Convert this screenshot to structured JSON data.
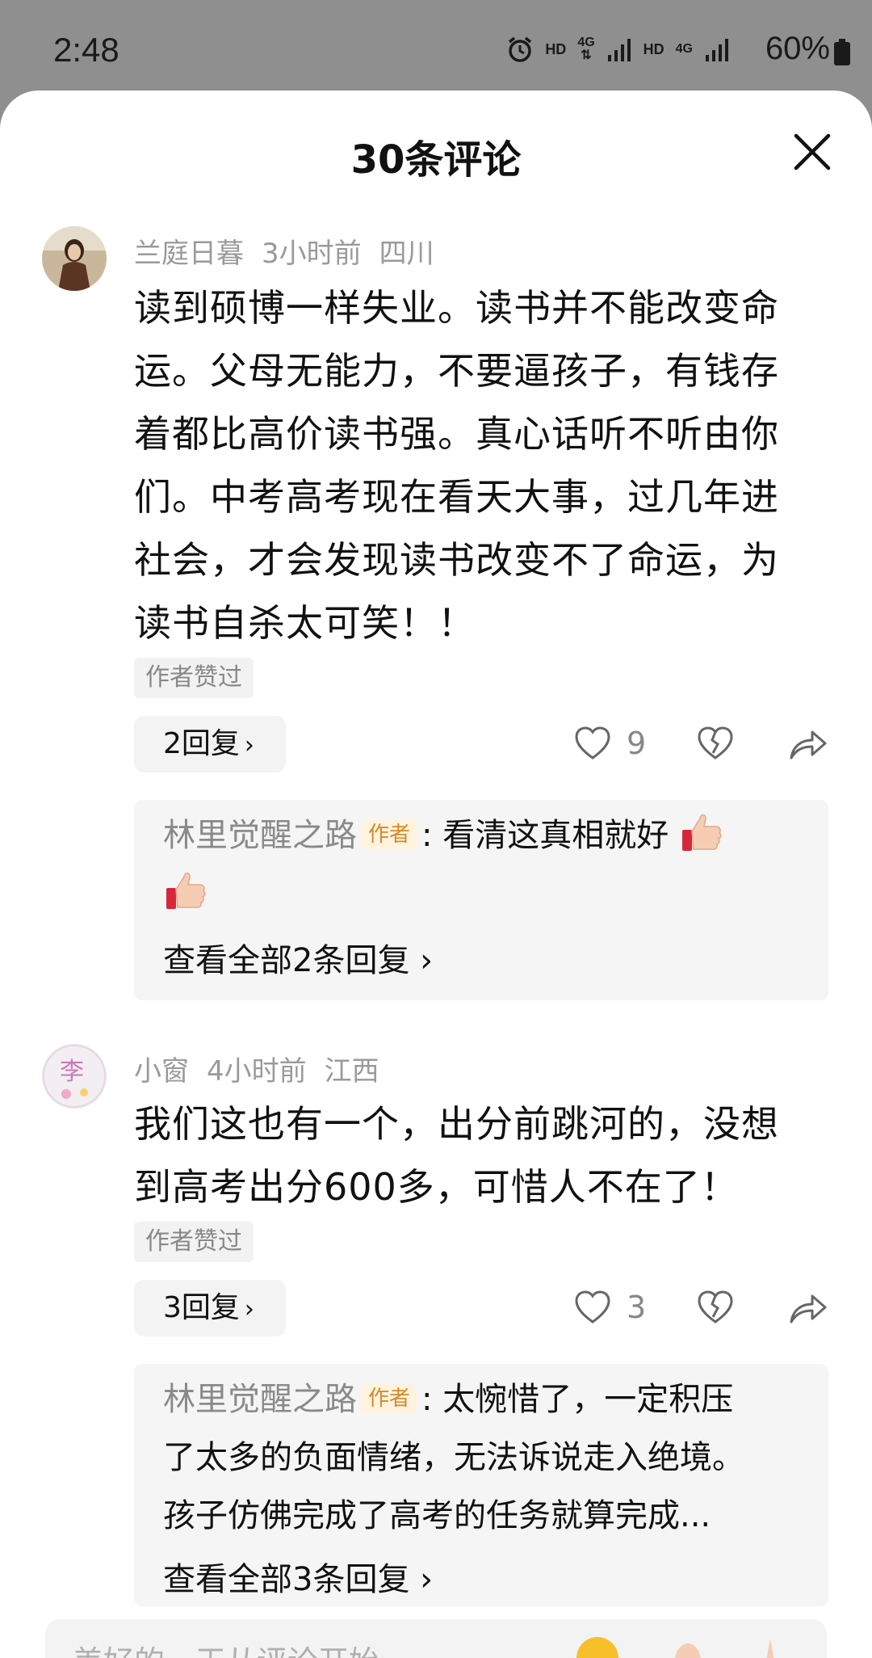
{
  "status_bar": {
    "time": "2:48",
    "hd1": "HD",
    "net1": "4G",
    "hd2": "HD",
    "net2": "4G",
    "battery": "60%"
  },
  "sheet": {
    "title": "30条评论"
  },
  "comments": [
    {
      "username": "兰庭日暮",
      "time": "3小时前",
      "location": "四川",
      "text": "读到硕博一样失业。读书并不能改变命运。父母无能力，不要逼孩子，有钱存着都比高价读书强。真心话听不听由你们。中考高考现在看天大事，过几年进社会，才会发现读书改变不了命运，为读书自杀太可笑！！",
      "text_lines": [
        "读到硕博一样失业。读书并不能改变命",
        "运。父母无能力，不要逼孩子，有钱存",
        "着都比高价读书强。真心话听不听由你",
        "们。中考高考现在看天大事，过几年进",
        "社会，才会发现读书改变不了命运，为",
        "读书自杀太可笑！！"
      ],
      "author_liked": "作者赞过",
      "reply_button": "2回复",
      "like_count": "9",
      "reply_preview": {
        "author": "林里觉醒之路",
        "author_tag": "作者",
        "text": "看清这真相就好",
        "view_all": "查看全部2条回复"
      }
    },
    {
      "username": "小窗",
      "time": "4小时前",
      "location": "江西",
      "text": "我们这也有一个，出分前跳河的，没想到高考出分600多，可惜人不在了！",
      "text_lines": [
        "我们这也有一个，出分前跳河的，没想",
        "到高考出分600多，可惜人不在了！"
      ],
      "author_liked": "作者赞过",
      "reply_button": "3回复",
      "like_count": "3",
      "reply_preview": {
        "author": "林里觉醒之路",
        "author_tag": "作者",
        "text_lines": [
          "太惋惜了，一定积压",
          "了太多的负面情绪，无法诉说走入绝境。",
          "孩子仿佛完成了高考的任务就算完成..."
        ],
        "view_all": "查看全部3条回复"
      }
    }
  ],
  "input": {
    "placeholder": "美好的一天从评论开始"
  }
}
